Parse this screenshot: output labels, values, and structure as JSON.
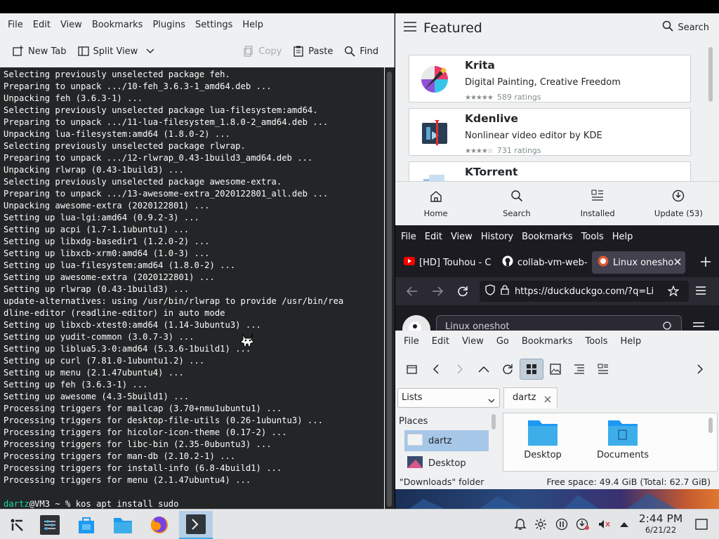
{
  "konsole": {
    "menu": [
      "File",
      "Edit",
      "View",
      "Bookmarks",
      "Plugins",
      "Settings",
      "Help"
    ],
    "toolbar": {
      "new_tab": "New Tab",
      "split_view": "Split View",
      "copy": "Copy",
      "paste": "Paste",
      "find": "Find"
    },
    "lines": [
      "Selecting previously unselected package feh.",
      "Preparing to unpack .../10-feh_3.6.3-1_amd64.deb ...",
      "Unpacking feh (3.6.3-1) ...",
      "Selecting previously unselected package lua-filesystem:amd64.",
      "Preparing to unpack .../11-lua-filesystem_1.8.0-2_amd64.deb ...",
      "Unpacking lua-filesystem:amd64 (1.8.0-2) ...",
      "Selecting previously unselected package rlwrap.",
      "Preparing to unpack .../12-rlwrap_0.43-1build3_amd64.deb ...",
      "Unpacking rlwrap (0.43-1build3) ...",
      "Selecting previously unselected package awesome-extra.",
      "Preparing to unpack .../13-awesome-extra_2020122801_all.deb ...",
      "Unpacking awesome-extra (2020122801) ...",
      "Setting up lua-lgi:amd64 (0.9.2-3) ...",
      "Setting up acpi (1.7-1.1ubuntu1) ...",
      "Setting up libxdg-basedir1 (1.2.0-2) ...",
      "Setting up libxcb-xrm0:amd64 (1.0-3) ...",
      "Setting up lua-filesystem:amd64 (1.8.0-2) ...",
      "Setting up awesome-extra (2020122801) ...",
      "Setting up rlwrap (0.43-1build3) ...",
      "update-alternatives: using /usr/bin/rlwrap to provide /usr/bin/rea",
      "dline-editor (readline-editor) in auto mode",
      "Setting up libxcb-xtest0:amd64 (1.14-3ubuntu3) ...",
      "Setting up yudit-common (3.0.7-3) ...",
      "Setting up liblua5.3-0:amd64 (5.3.6-1build1) ...",
      "Setting up curl (7.81.0-1ubuntu1.2) ...",
      "Setting up menu (2.1.47ubuntu4) ...",
      "Setting up feh (3.6.3-1) ...",
      "Setting up awesome (4.3-5build1) ...",
      "Processing triggers for mailcap (3.70+nmu1ubuntu1) ...",
      "Processing triggers for desktop-file-utils (0.26-1ubuntu3) ...",
      "Processing triggers for hicolor-icon-theme (0.17-2) ...",
      "Processing triggers for libc-bin (2.35-0ubuntu3) ...",
      "Processing triggers for man-db (2.10.2-1) ...",
      "Processing triggers for install-info (6.8-4build1) ...",
      "Processing triggers for menu (2.1.47ubuntu4) ...",
      ""
    ],
    "prompt_user": "dartz",
    "prompt_rest": "@VM3 ~ % kos apt install sudo"
  },
  "discover": {
    "title": "Featured",
    "search": "Search",
    "apps": [
      {
        "name": "Krita",
        "desc": "Digital Painting, Creative Freedom",
        "stars": "★★★★★",
        "ratings": "589 ratings"
      },
      {
        "name": "Kdenlive",
        "desc": "Nonlinear video editor by KDE",
        "stars": "★★★★☆",
        "ratings": "731 ratings"
      },
      {
        "name": "KTorrent",
        "desc": "",
        "stars": "",
        "ratings": ""
      }
    ],
    "nav": [
      "Home",
      "Search",
      "Installed",
      "Update (53)"
    ]
  },
  "firefox": {
    "menu": [
      "File",
      "Edit",
      "View",
      "History",
      "Bookmarks",
      "Tools",
      "Help"
    ],
    "tabs": [
      "[HD] Touhou - C",
      "collab-vm-web-",
      "Linux onesho"
    ],
    "url": "https://duckduckgo.com/?q=Li",
    "search_text": "Linux oneshot"
  },
  "dolphin": {
    "menu": [
      "File",
      "Edit",
      "View",
      "Go",
      "Bookmarks",
      "Tools",
      "Help"
    ],
    "panel_combo": "Lists",
    "tab": "dartz",
    "places_title": "Places",
    "places": [
      "dartz",
      "Desktop"
    ],
    "files": [
      "Desktop",
      "Documents"
    ],
    "status_left": "\"Downloads\" folder",
    "status_right": "Free space: 49.4 GiB (Total: 62.7 GiB)"
  },
  "panel": {
    "time": "2:44 PM",
    "date": "6/21/22"
  },
  "colors": {
    "terminal_bg": "#232627",
    "prompt_green": "#1cdc9a",
    "accent": "#3daee9"
  }
}
